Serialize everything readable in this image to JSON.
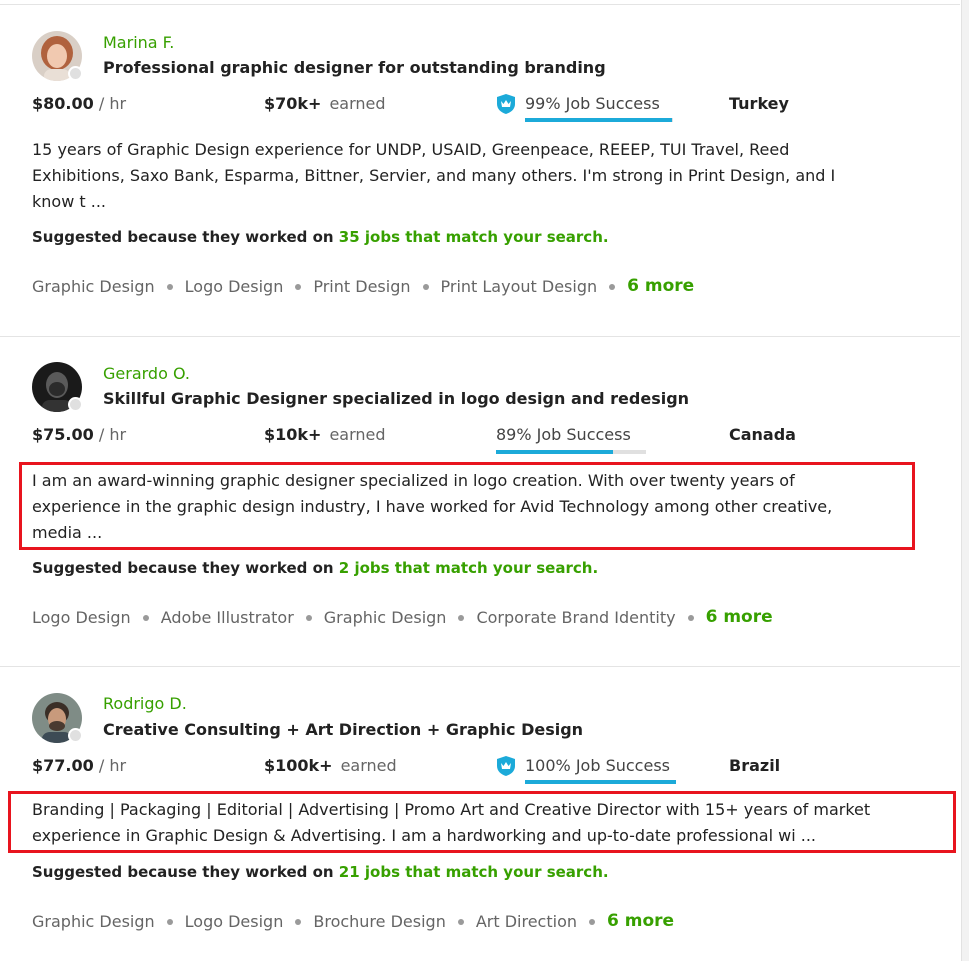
{
  "freelancers": [
    {
      "name": "Marina F.",
      "title": "Professional graphic designer for outstanding branding",
      "rate": "$80.00",
      "rate_unit": "/ hr",
      "earned_amount": "$70k+",
      "earned_label": "earned",
      "job_success": "99% Job Success",
      "job_success_fraction": 0.99,
      "top_rated_badge": true,
      "country": "Turkey",
      "description_lines": [
        "15 years of Graphic Design experience for UNDP, USAID, Greenpeace, REEEP, TUI Travel, Reed",
        "Exhibitions, Saxo Bank, Esparma, Bittner, Servier, and many others. I'm strong in Print Design, and I",
        "know t ..."
      ],
      "suggest_prefix": "Suggested because they worked on",
      "suggest_link": "35 jobs that match your search.",
      "skills": [
        "Graphic Design",
        "Logo Design",
        "Print Design",
        "Print Layout Design"
      ],
      "more": "6 more",
      "description_highlighted": false
    },
    {
      "name": "Gerardo O.",
      "title": "Skillful Graphic Designer specialized in logo design and redesign",
      "rate": "$75.00",
      "rate_unit": "/ hr",
      "earned_amount": "$10k+",
      "earned_label": "earned",
      "job_success": "89% Job Success",
      "job_success_fraction": 0.89,
      "top_rated_badge": false,
      "country": "Canada",
      "description_lines": [
        "I am an award-winning graphic designer specialized in logo creation. With over twenty years of",
        "experience in the graphic design industry, I have worked for Avid Technology among other creative,",
        "media ..."
      ],
      "suggest_prefix": "Suggested because they worked on",
      "suggest_link": "2 jobs that match your search.",
      "skills": [
        "Logo Design",
        "Adobe Illustrator",
        "Graphic Design",
        "Corporate Brand Identity"
      ],
      "more": "6 more",
      "description_highlighted": true
    },
    {
      "name": "Rodrigo D.",
      "title": "Creative Consulting + Art Direction + Graphic Design",
      "rate": "$77.00",
      "rate_unit": "/ hr",
      "earned_amount": "$100k+",
      "earned_label": "earned",
      "job_success": "100% Job Success",
      "job_success_fraction": 1.0,
      "top_rated_badge": true,
      "country": "Brazil",
      "description_lines": [
        "Branding | Packaging | Editorial | Advertising | Promo Art and Creative Director with 15+ years of market",
        "experience in Graphic Design & Advertising. I am a hardworking and up-to-date professional wi ..."
      ],
      "suggest_prefix": "Suggested because they worked on",
      "suggest_link": "21 jobs that match your search.",
      "skills": [
        "Graphic Design",
        "Logo Design",
        "Brochure Design",
        "Art Direction"
      ],
      "more": "6 more",
      "description_highlighted": true
    }
  ],
  "colors": {
    "accent_green": "#37a000",
    "job_success_blue": "#1caad9",
    "highlight_red": "#e8141e"
  },
  "icons": {
    "top_rated_badge": "shield-crown-icon",
    "online_status": "status-dot-icon"
  }
}
